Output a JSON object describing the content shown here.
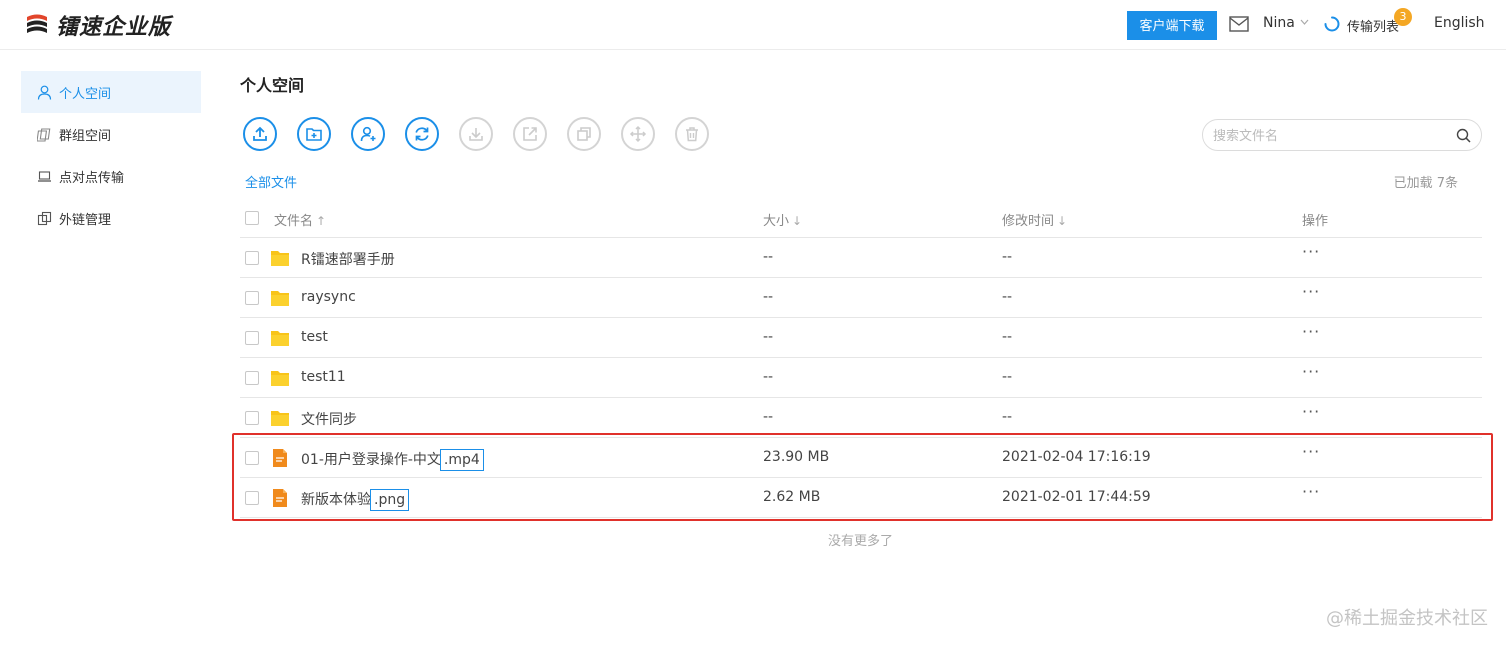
{
  "header": {
    "brand": "镭速企业版",
    "client_download": "客户端下载",
    "user": "Nina",
    "transfer_label": "传输列表",
    "transfer_badge": "3",
    "language": "English",
    "accent_color": "#1b8fe8"
  },
  "sidebar": {
    "items": [
      {
        "label": "个人空间",
        "icon": "user-icon",
        "active": true
      },
      {
        "label": "群组空间",
        "icon": "group-icon",
        "active": false
      },
      {
        "label": "点对点传输",
        "icon": "laptop-icon",
        "active": false
      },
      {
        "label": "外链管理",
        "icon": "link-copy-icon",
        "active": false
      }
    ]
  },
  "main": {
    "title": "个人空间",
    "toolbar": [
      {
        "name": "upload-icon",
        "enabled": true
      },
      {
        "name": "new-folder-icon",
        "enabled": true
      },
      {
        "name": "add-user-icon",
        "enabled": true
      },
      {
        "name": "refresh-icon",
        "enabled": true
      },
      {
        "name": "download-icon",
        "enabled": false
      },
      {
        "name": "share-icon",
        "enabled": false
      },
      {
        "name": "copy-icon",
        "enabled": false
      },
      {
        "name": "move-icon",
        "enabled": false
      },
      {
        "name": "delete-icon",
        "enabled": false
      }
    ],
    "search_placeholder": "搜索文件名",
    "breadcrumb": "全部文件",
    "loaded_count": "已加载 7条",
    "columns": {
      "name": "文件名",
      "size": "大小",
      "modified": "修改时间",
      "actions": "操作"
    },
    "rows": [
      {
        "type": "folder",
        "name": "R镭速部署手册",
        "ext": "",
        "size": "--",
        "modified": "--",
        "actions": "···"
      },
      {
        "type": "folder",
        "name": "raysync",
        "ext": "",
        "size": "--",
        "modified": "--",
        "actions": "···"
      },
      {
        "type": "folder",
        "name": "test",
        "ext": "",
        "size": "--",
        "modified": "--",
        "actions": "···"
      },
      {
        "type": "folder",
        "name": "test11",
        "ext": "",
        "size": "--",
        "modified": "--",
        "actions": "···"
      },
      {
        "type": "folder",
        "name": "文件同步",
        "ext": "",
        "size": "--",
        "modified": "--",
        "actions": "···"
      },
      {
        "type": "file",
        "name": "01-用户登录操作-中文",
        "ext": ".mp4",
        "size": "23.90 MB",
        "modified": "2021-02-04 17:16:19",
        "actions": "···"
      },
      {
        "type": "file",
        "name": "新版本体验",
        "ext": ".png",
        "size": "2.62 MB",
        "modified": "2021-02-01 17:44:59",
        "actions": "···"
      }
    ],
    "no_more": "没有更多了"
  },
  "watermark": "@稀土掘金技术社区"
}
